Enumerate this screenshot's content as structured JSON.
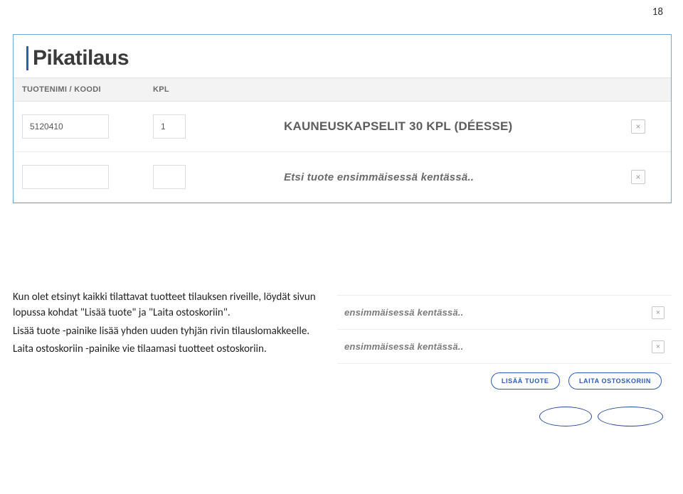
{
  "page_number": "18",
  "top_panel": {
    "title": "Pikatilaus",
    "headers": {
      "name": "TUOTENIMI / KOODI",
      "qty": "KPL"
    },
    "rows": [
      {
        "code": "5120410",
        "qty": "1",
        "desc": "KAUNEUSKAPSELIT 30 KPL (DÉESSE)",
        "italic": false
      },
      {
        "code": "",
        "qty": "",
        "desc": "Etsi tuote ensimmäisessä kentässä..",
        "italic": true
      }
    ]
  },
  "bottom_panel": {
    "rows": [
      {
        "desc": "ensimmäisessä kentässä.."
      },
      {
        "desc": "ensimmäisessä kentässä.."
      }
    ],
    "buttons": {
      "add": "LISÄÄ TUOTE",
      "cart": "LAITA OSTOSKORIIN"
    }
  },
  "instructions": {
    "p1": "Kun olet etsinyt kaikki tilattavat tuotteet tilauksen riveille, löydät sivun lopussa kohdat \"Lisää tuote\" ja \"Laita ostoskoriin\".",
    "p2": "Lisää tuote -painike lisää yhden uuden tyhjän rivin tilauslomakkeelle.",
    "p3": "Laita ostoskoriin -painike vie tilaamasi tuotteet ostoskoriin."
  }
}
